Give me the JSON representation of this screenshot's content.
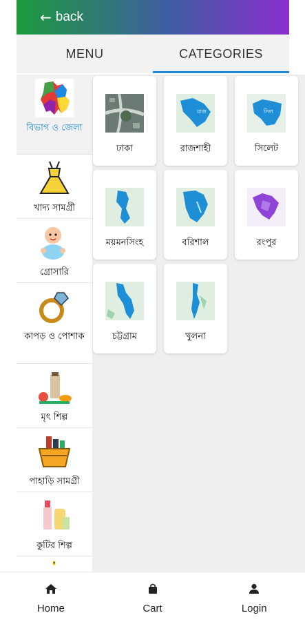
{
  "header": {
    "back_label": "back",
    "gradient": [
      "#1c9a3c",
      "#8a2fd0"
    ]
  },
  "tabs": [
    {
      "label": "MENU",
      "active": false
    },
    {
      "label": "CATEGORIES",
      "active": true
    }
  ],
  "accent_color": "#1e88d6",
  "sidebar": {
    "items": [
      {
        "label": "বিভাগ ও জেলা",
        "icon": "bangladesh-map-icon",
        "active": true
      },
      {
        "label": "খাদ্য সামগ্রী",
        "icon": "dress-icon"
      },
      {
        "label": "গ্রোসারি",
        "icon": "baby-icon"
      },
      {
        "label": "কাপড় ও পোশাক",
        "icon": "ring-icon"
      },
      {
        "label": "মৃৎ শিল্প",
        "icon": "groceries-icon"
      },
      {
        "label": "পাহাড়ি সামগ্রী",
        "icon": "basket-icon"
      },
      {
        "label": "কুটির শিল্প",
        "icon": "cosmetics-icon"
      }
    ]
  },
  "categories": [
    {
      "name": "ঢাকা",
      "icon": "city-photo-icon"
    },
    {
      "name": "রাজশাহী",
      "icon": "division-map-icon"
    },
    {
      "name": "সিলেট",
      "icon": "division-map-icon"
    },
    {
      "name": "ময়মনসিংহ",
      "icon": "division-map-icon"
    },
    {
      "name": "বরিশাল",
      "icon": "division-map-icon"
    },
    {
      "name": "রংপুর",
      "icon": "division-map-icon"
    },
    {
      "name": "চট্টগ্রাম",
      "icon": "division-map-icon"
    },
    {
      "name": "খুলনা",
      "icon": "division-map-icon"
    }
  ],
  "bottom_nav": [
    {
      "label": "Home",
      "icon": "home-icon"
    },
    {
      "label": "Cart",
      "icon": "bag-icon"
    },
    {
      "label": "Login",
      "icon": "user-icon"
    }
  ]
}
